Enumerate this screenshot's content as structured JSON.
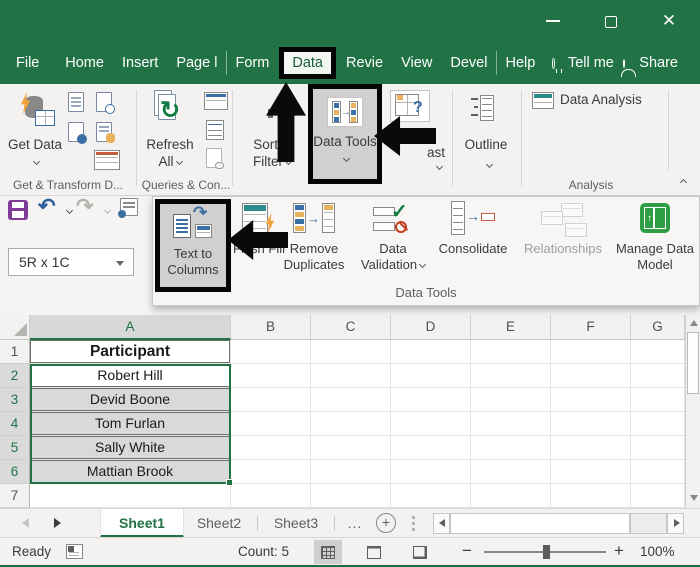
{
  "title_bar": {
    "minimize_icon": "minimize",
    "maximize_icon": "maximize",
    "close_glyph": "✕"
  },
  "menu": {
    "tabs": [
      {
        "label": "File"
      },
      {
        "label": "Home"
      },
      {
        "label": "Insert"
      },
      {
        "label": "Page l"
      },
      {
        "label": "Form"
      },
      {
        "label": "Data"
      },
      {
        "label": "Revie"
      },
      {
        "label": "View"
      },
      {
        "label": "Devel"
      },
      {
        "label": "Help"
      }
    ],
    "tell_me": "Tell me",
    "share": "Share"
  },
  "ribbon": {
    "get_data_label": "Get Data",
    "refresh_all_label": "Refresh All",
    "sort_filter_label": "Sort & Filter",
    "data_tools_label": "Data Tools",
    "forecast_label_partial": "ast",
    "outline_label": "Outline",
    "data_analysis_label": "Data Analysis",
    "group_get_transform": "Get & Transform D...",
    "group_queries": "Queries & Con...",
    "group_analysis": "Analysis"
  },
  "quick_access": {
    "name_box_value": "5R x 1C",
    "undo_glyph": "↶",
    "redo_glyph": "↷",
    "refresh_glyph": "↻"
  },
  "data_tools_panel": {
    "text_to_columns": "Text to Columns",
    "flash_fill": "Flash Fill",
    "remove_duplicates": "Remove Duplicates",
    "data_validation": "Data Validation",
    "consolidate": "Consolidate",
    "relationships": "Relationships",
    "manage_data_model": "Manage Data Model",
    "group_label": "Data Tools",
    "forecast_question_glyph": "?"
  },
  "spreadsheet": {
    "columns": [
      "A",
      "B",
      "C",
      "D",
      "E",
      "F",
      "G"
    ],
    "rows": [
      "1",
      "2",
      "3",
      "4",
      "5",
      "6",
      "7"
    ],
    "cells": {
      "A1": "Participant",
      "A2": "Robert Hill",
      "A3": "Devid Boone",
      "A4": "Tom Furlan",
      "A5": "Sally White",
      "A6": "Mattian Brook"
    }
  },
  "sheet_bar": {
    "tabs": [
      "Sheet1",
      "Sheet2",
      "Sheet3"
    ],
    "overflow": "...",
    "add_sheet_glyph": "+"
  },
  "status_bar": {
    "mode": "Ready",
    "count": "Count: 5",
    "zoom_out": "−",
    "zoom_in": "+",
    "zoom_level": "100%"
  },
  "colors": {
    "excel_green": "#217346",
    "highlight_gray": "#d2d0ce",
    "selection_fill": "#d9d9d9",
    "annotation_black": "#0a0a0a"
  }
}
